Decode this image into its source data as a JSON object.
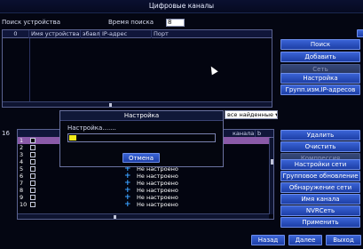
{
  "window": {
    "title": "Цифровые каналы"
  },
  "search_bar": {
    "label": "Поиск устройства",
    "time_label": "Время поиска",
    "time_value": "8"
  },
  "device_table": {
    "columns": [
      "0",
      "Имя устройства",
      "эбавл:",
      "IP-адрес",
      "Порт"
    ]
  },
  "right_buttons_top": [
    {
      "label": "Поиск",
      "enabled": true
    },
    {
      "label": "Добавить",
      "enabled": true
    },
    {
      "label": "Сеть",
      "enabled": false
    },
    {
      "label": "Настройка",
      "enabled": true
    },
    {
      "label": "Групп.изм.IP-адресов",
      "enabled": true
    }
  ],
  "filter_dropdown": {
    "value": "все найденные"
  },
  "channel_table": {
    "partial_header": "канала",
    "partial_header_2": "b",
    "count_label": "16",
    "rows": [
      {
        "num": "1",
        "status": "",
        "selected": true
      },
      {
        "num": "2",
        "status": ""
      },
      {
        "num": "3",
        "status": ""
      },
      {
        "num": "4",
        "status": ""
      },
      {
        "num": "5",
        "status": "Не настроено"
      },
      {
        "num": "6",
        "status": "Не настроено"
      },
      {
        "num": "7",
        "status": "Не настроено"
      },
      {
        "num": "8",
        "status": "Не настроено"
      },
      {
        "num": "9",
        "status": "Не настроено"
      },
      {
        "num": "10",
        "status": "Не настроено"
      }
    ]
  },
  "right_buttons_bottom": [
    {
      "label": "Удалить",
      "enabled": true
    },
    {
      "label": "Очистить",
      "enabled": true
    },
    {
      "label": "Компрессия",
      "enabled": false
    },
    {
      "label": "Настройки сети",
      "enabled": true
    },
    {
      "label": "Групповое обновление",
      "enabled": true
    },
    {
      "label": "Обнаружение сети",
      "enabled": true
    },
    {
      "label": "Имя канала",
      "enabled": true
    },
    {
      "label": "NVRСеть",
      "enabled": true
    },
    {
      "label": "Применить",
      "enabled": true
    }
  ],
  "footer": {
    "back": "Назад",
    "next": "Далее",
    "exit": "Выход"
  },
  "dialog": {
    "title": "Настройка",
    "message": "Настройка.......",
    "progress": 0.05,
    "cancel": "Отмена"
  },
  "colors": {
    "accent": "#2a52c8",
    "progress": "#f1ea1a",
    "selected_row": "#8a5aa8"
  }
}
